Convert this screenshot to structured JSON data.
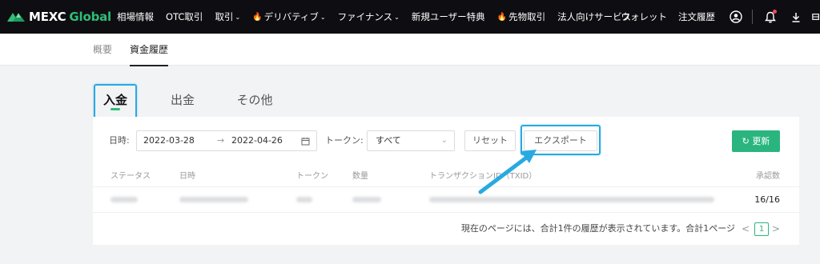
{
  "brand": {
    "name": "MEXC",
    "suffix": "Global"
  },
  "nav": {
    "items": [
      "相場情報",
      "OTC取引",
      "取引",
      "デリバティブ",
      "ファイナンス",
      "新規ユーザー特典",
      "先物取引",
      "法人向けサービス"
    ],
    "right": [
      "ウォレット",
      "注文履歴"
    ]
  },
  "subnav": [
    "概要",
    "資金履歴"
  ],
  "tabs": [
    "入金",
    "出金",
    "その他"
  ],
  "filters": {
    "date_label": "日時:",
    "start_date": "2022-03-28",
    "arrow": "→",
    "end_date": "2022-04-26",
    "token_label": "トークン:",
    "token_value": "すべて",
    "reset": "リセット",
    "export": "エクスポート",
    "refresh": "更新"
  },
  "table": {
    "headers": [
      "ステータス",
      "日時",
      "トークン",
      "数量",
      "トランザクションID（TXID）",
      "承認数"
    ],
    "rows": [
      {
        "confirmations": "16/16"
      }
    ]
  },
  "pagination": {
    "summary": "現在のページには、合計1件の履歴が表示されています。合計1ページ",
    "current": "1",
    "prev": "<",
    "next": ">"
  },
  "colors": {
    "brand_green": "#2fbd77",
    "button_green": "#2ab57f",
    "highlight": "#28aae1",
    "nav_bg": "#0e0e12"
  }
}
